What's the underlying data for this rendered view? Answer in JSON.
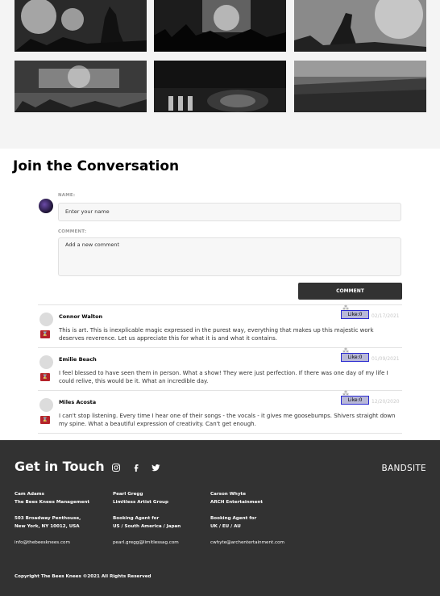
{
  "gallery": {
    "photos": [
      "concert-crowd-hands-photo",
      "concert-stage-lights-photo",
      "singer-silhouette-photo",
      "stage-lights-crowd-photo",
      "dj-turntable-photo",
      "festival-crowd-photo"
    ]
  },
  "conversation": {
    "title": "Join the Conversation",
    "name_label": "NAME:",
    "name_placeholder": "Enter your name",
    "comment_label": "COMMENT:",
    "comment_placeholder": "Add a new comment",
    "submit_label": "COMMENT"
  },
  "comments": [
    {
      "name": "Connor Walton",
      "like_label": "Like:0",
      "date": "02/17/2021",
      "text": "This is art. This is inexplicable magic expressed in the purest way, everything that makes up this majestic work deserves reverence. Let us appreciate this for what it is and what it contains."
    },
    {
      "name": "Emilie Beach",
      "like_label": "Like:0",
      "date": "01/09/2021",
      "text": "I feel blessed to have seen them in person. What a show! They were just perfection. If there was one day of my life I could relive, this would be it. What an incredible day."
    },
    {
      "name": "Miles Acosta",
      "like_label": "Like:0",
      "date": "12/20/2020",
      "text": "I can't stop listening. Every time I hear one of their songs - the vocals - it gives me goosebumps. Shivers straight down my spine. What a beautiful expression of creativity. Can't get enough."
    }
  ],
  "footer": {
    "title": "Get in Touch",
    "brand": "BANDSITE",
    "contacts": [
      {
        "name": "Cam Adams",
        "company": "The Bees Knees Management",
        "address1": "503 Broadway Penthouse,",
        "address2": "New York, NY 10012, USA",
        "email": "info@thebeesknees.com"
      },
      {
        "name": "Pearl Gregg",
        "company": "Limitless Artist Group",
        "address1": "Booking Agent for",
        "address2": "US / South America / Japan",
        "email": "pearl.gregg@limitlessag.com"
      },
      {
        "name": "Carson Whyte",
        "company": "ARCH Entertainment",
        "address1": "Booking Agent for",
        "address2": "UK / EU / AU",
        "email": "cwhyte@archentertainment.com"
      }
    ],
    "copyright": "Copyright The Bees Knees ©2021 All Rights Reserved"
  }
}
